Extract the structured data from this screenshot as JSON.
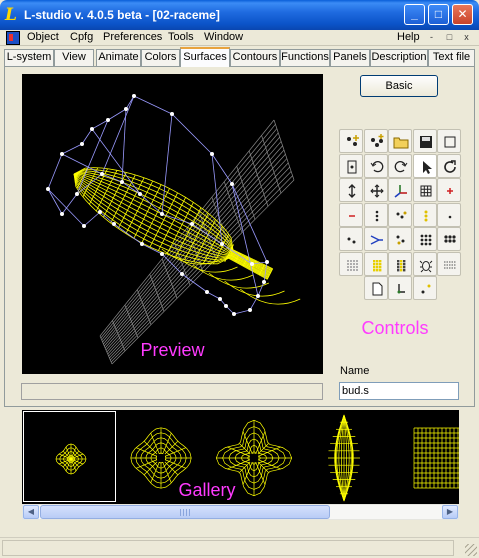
{
  "window": {
    "logo": "L",
    "title": "L-studio v. 4.0.5 beta - [02-raceme]",
    "minimize": "_",
    "maximize": "□",
    "close": "✕"
  },
  "menu": {
    "items": [
      "Object",
      "Cpfg",
      "Preferences",
      "Tools",
      "Window"
    ],
    "help": "Help",
    "mdi": [
      "-",
      "□",
      "x"
    ]
  },
  "tabs": {
    "labels": [
      "L-system",
      "View",
      "Animate",
      "Colors",
      "Surfaces",
      "Contours",
      "Functions",
      "Panels",
      "Description",
      "Text file"
    ],
    "active": "Surfaces"
  },
  "preview": {
    "label": "Preview"
  },
  "controls": {
    "basic_label": "Basic",
    "label": "Controls",
    "buttons": [
      "add-point-icon",
      "add-points-icon",
      "open-folder-icon",
      "save-disk-icon",
      "square-icon",
      "center-icon",
      "undo-icon",
      "redo-icon",
      "pointer-icon",
      "refresh-icon",
      "vertical-move-icon",
      "move-cross-icon",
      "axes-icon",
      "grid-icon",
      "red-plus-icon",
      "red-minus-icon",
      "dots-vertical-icon",
      "dots-diagonal-icon",
      "yellow-dots-icon",
      "single-dot-icon",
      "two-dots-icon",
      "arrow-split-icon",
      "three-dots-icon",
      "dot-grid-icon",
      "dot-grid-dense-icon",
      "gray-grid-icon",
      "yellow-grid-icon",
      "yellow-grid-b-icon",
      "bug-icon",
      "grid-lines-icon",
      "page-icon",
      "corner-icon",
      "diagonal-dots-icon"
    ]
  },
  "name": {
    "label": "Name",
    "value": "bud.s"
  },
  "gallery": {
    "label": "Gallery"
  },
  "scroll": {
    "left": "◀",
    "right": "▶"
  },
  "colors": {
    "accent": "#ff3bff",
    "wire": "#ffff00",
    "hull": "#9090ff"
  }
}
